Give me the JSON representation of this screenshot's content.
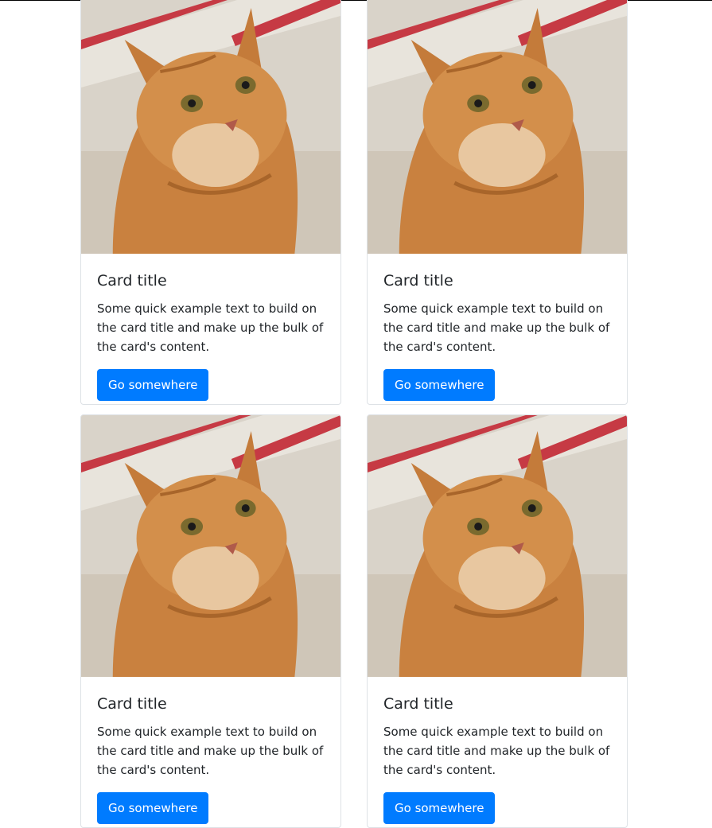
{
  "colors": {
    "primary": "#007bff",
    "border": "#dee2e6",
    "text": "#212529"
  },
  "cards": [
    {
      "image_icon": "cat-photo",
      "title": "Card title",
      "text": "Some quick example text to build on the card title and make up the bulk of the card's content.",
      "button_label": "Go somewhere"
    },
    {
      "image_icon": "cat-photo",
      "title": "Card title",
      "text": "Some quick example text to build on the card title and make up the bulk of the card's content.",
      "button_label": "Go somewhere"
    },
    {
      "image_icon": "cat-photo",
      "title": "Card title",
      "text": "Some quick example text to build on the card title and make up the bulk of the card's content.",
      "button_label": "Go somewhere"
    },
    {
      "image_icon": "cat-photo",
      "title": "Card title",
      "text": "Some quick example text to build on the card title and make up the bulk of the card's content.",
      "button_label": "Go somewhere"
    }
  ]
}
